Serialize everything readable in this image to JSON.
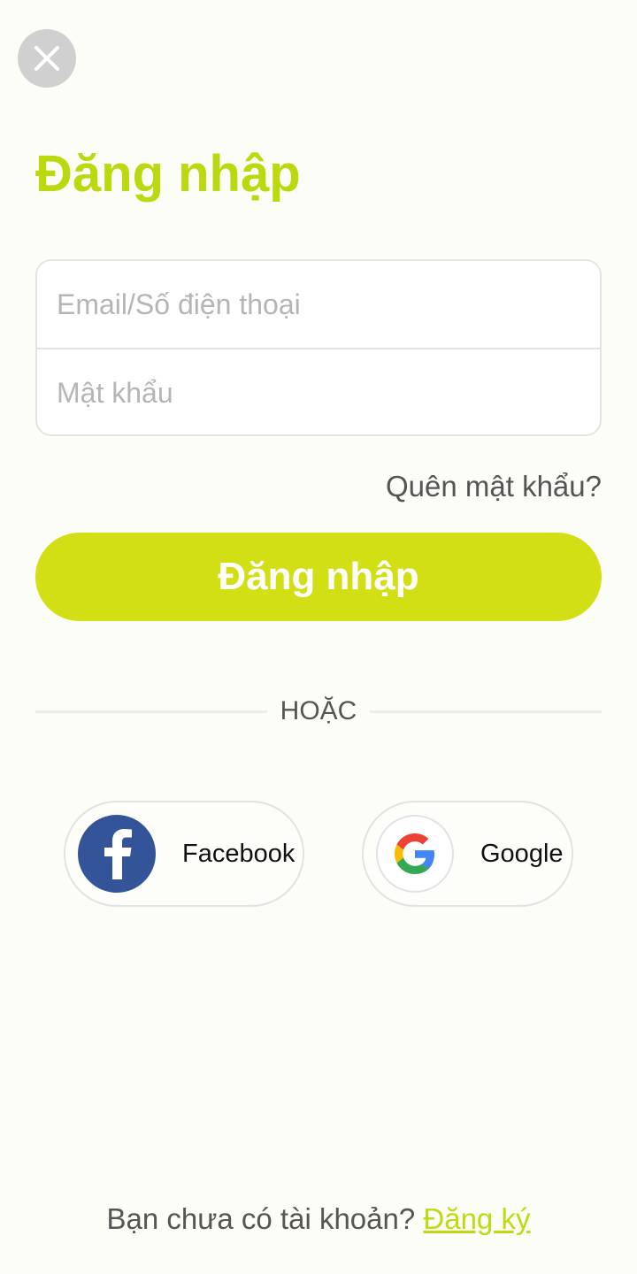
{
  "header": {
    "close_icon": "close-icon"
  },
  "page": {
    "title": "Đăng nhập"
  },
  "form": {
    "email_placeholder": "Email/Số điện thoại",
    "email_value": "",
    "password_placeholder": "Mật khẩu",
    "password_value": "",
    "forgot_password": "Quên mật khẩu?",
    "submit_label": "Đăng nhập"
  },
  "divider": {
    "label": "HOẶC"
  },
  "social": {
    "facebook": {
      "label": "Facebook",
      "icon": "facebook-icon"
    },
    "google": {
      "label": "Google",
      "icon": "google-icon"
    }
  },
  "footer": {
    "prompt": "Bạn chưa có tài khoản?",
    "signup_link": "Đăng ký"
  },
  "colors": {
    "accent": "#d3df15",
    "title": "#bcd80f",
    "facebook": "#34549a",
    "background": "#fcfdf6"
  }
}
